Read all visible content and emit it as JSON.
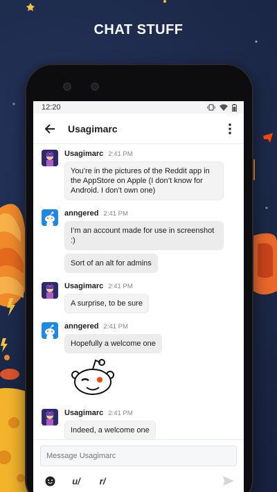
{
  "promo": {
    "headline": "CHAT STUFF"
  },
  "status_bar": {
    "time": "12:20"
  },
  "header": {
    "title": "Usagimarc"
  },
  "messages": [
    {
      "author": "Usagimarc",
      "time": "2:41 PM",
      "bubbles": [
        "You’re in the pictures of the Reddit app in the AppStore on Apple (I don’t know for Android. I don’t own one)"
      ]
    },
    {
      "author": "anngered",
      "time": "2:41 PM",
      "bubbles": [
        "I’m an account made for use in screenshot :)",
        "Sort of an alt for admins"
      ]
    },
    {
      "author": "Usagimarc",
      "time": "2:41 PM",
      "bubbles": [
        "A surprise, to be sure"
      ]
    },
    {
      "author": "anngered",
      "time": "2:41 PM",
      "bubbles": [
        "Hopefully a welcome one"
      ]
    },
    {
      "author": "Usagimarc",
      "time": "2:41 PM",
      "bubbles": [
        "Indeed, a welcome one"
      ]
    }
  ],
  "composer": {
    "placeholder": "Message Usagimarc",
    "user_tool": "u/",
    "subreddit_tool": "r/"
  },
  "colors": {
    "background": "#1b2746",
    "accent_blue": "#1e88e5",
    "snoo_red": "#ff4500"
  },
  "icons": [
    "back-arrow-icon",
    "more-vert-icon",
    "emoji-icon",
    "send-icon",
    "snoo-sticker"
  ]
}
